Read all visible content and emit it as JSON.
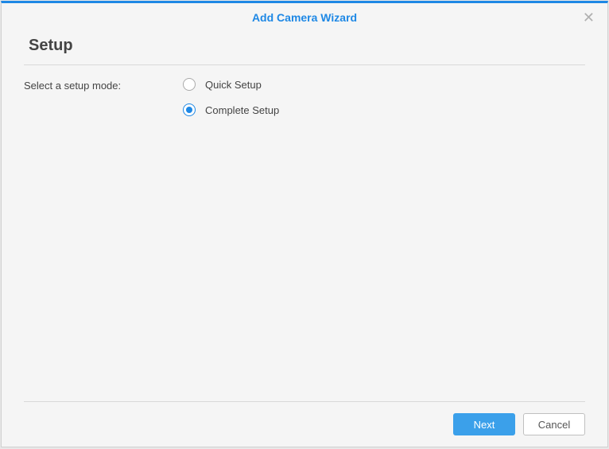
{
  "dialog": {
    "title": "Add Camera Wizard"
  },
  "setup": {
    "heading": "Setup",
    "prompt": "Select a setup mode:",
    "options": [
      {
        "label": "Quick Setup",
        "selected": false
      },
      {
        "label": "Complete Setup",
        "selected": true
      }
    ]
  },
  "footer": {
    "next": "Next",
    "cancel": "Cancel"
  }
}
